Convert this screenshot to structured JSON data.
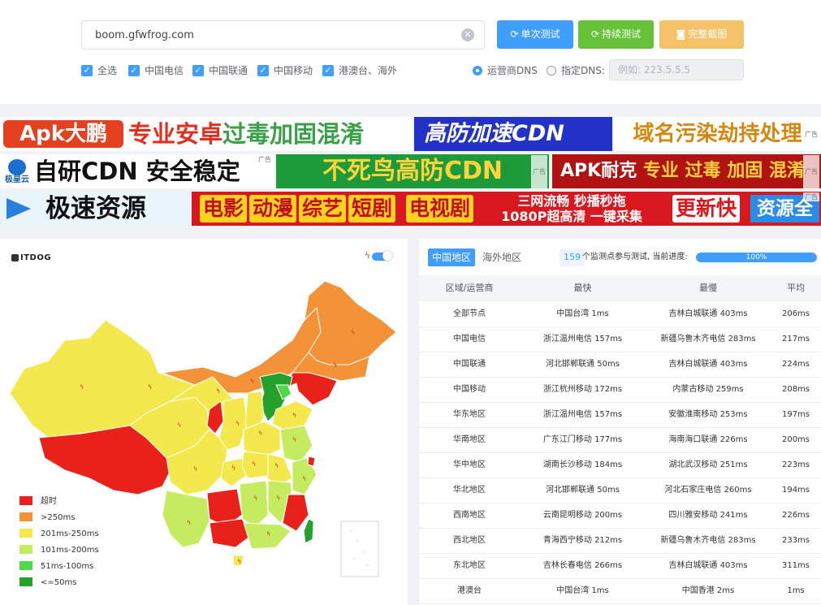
{
  "search": {
    "value": "boom.gfwfrog.com",
    "clear_icon": "circle-x-icon"
  },
  "actions": {
    "single_test": "单次测试",
    "continuous_test": "持续测试",
    "full_screenshot": "完整截图"
  },
  "filters": [
    {
      "label": "全选",
      "checked": true
    },
    {
      "label": "中国电信",
      "checked": true
    },
    {
      "label": "中国联通",
      "checked": true
    },
    {
      "label": "中国移动",
      "checked": true
    },
    {
      "label": "港澳台、海外",
      "checked": true
    }
  ],
  "dns": {
    "operator_dns": "运营商DNS",
    "custom_dns": "指定DNS:",
    "selected": "运营商DNS",
    "placeholder": "例如: 223.5.5.5"
  },
  "ads": {
    "ad1_badge": "Apk大鹏",
    "ad1_text": "专业安卓",
    "ad1_highlight": "过毒加固混淆",
    "ad2": "高防加速CDN",
    "ad3": "域名污染劫持处理",
    "ad4_logo": "极星云",
    "ad4": "自研CDN 安全稳定",
    "ad5": "不死鸟高防CDN",
    "ad6_a": "APK耐克",
    "ad6_b": "专业 过毒 加固 混淆",
    "ad7": "极速资源",
    "ad8_chips": [
      "电影",
      "动漫",
      "综艺",
      "短剧",
      "电视剧"
    ],
    "ad8_mid1": "三网流畅   秒播秒拖",
    "ad8_mid2": "1080P超高清   一键采集",
    "ad8_update": "更新快",
    "ad8_res": "资源全",
    "ad_tag": "广告"
  },
  "map": {
    "logo": "ITDOG",
    "legend": [
      {
        "label": "超时",
        "color": "#e8211b"
      },
      {
        "label": ">250ms",
        "color": "#f39237"
      },
      {
        "label": "201ms-250ms",
        "color": "#f3e84c"
      },
      {
        "label": "101ms-200ms",
        "color": "#c5ec61"
      },
      {
        "label": "51ms-100ms",
        "color": "#4fd84e"
      },
      {
        "label": "<=50ms",
        "color": "#23a12a"
      }
    ]
  },
  "results": {
    "tabs": [
      "中国地区",
      "海外地区"
    ],
    "active_tab": "中国地区",
    "node_count": "159",
    "progress_text": "个监测点参与测试, 当前进度:",
    "progress_percent": 100,
    "progress_label": "100%",
    "columns": [
      "区域/运营商",
      "最快",
      "最慢",
      "平均"
    ],
    "rows": [
      [
        "全部节点",
        "中国台湾 1ms",
        "吉林白城联通 403ms",
        "206ms"
      ],
      [
        "中国电信",
        "浙江温州电信 157ms",
        "新疆乌鲁木齐电信 283ms",
        "217ms"
      ],
      [
        "中国联通",
        "河北邯郸联通 50ms",
        "吉林白城联通 403ms",
        "224ms"
      ],
      [
        "中国移动",
        "浙江杭州移动 172ms",
        "内蒙古移动 259ms",
        "208ms"
      ],
      [
        "华东地区",
        "浙江温州电信 157ms",
        "安徽淮南移动 253ms",
        "197ms"
      ],
      [
        "华南地区",
        "广东江门移动 177ms",
        "海南海口联通 226ms",
        "200ms"
      ],
      [
        "华中地区",
        "湖南长沙移动 184ms",
        "湖北武汉移动 251ms",
        "223ms"
      ],
      [
        "华北地区",
        "河北邯郸联通 50ms",
        "河北石家庄电信 260ms",
        "194ms"
      ],
      [
        "西南地区",
        "云南昆明移动 200ms",
        "四川雅安移动 241ms",
        "226ms"
      ],
      [
        "西北地区",
        "青海西宁移动 212ms",
        "新疆乌鲁木齐电信 283ms",
        "233ms"
      ],
      [
        "东北地区",
        "吉林长春电信 266ms",
        "吉林白城联通 403ms",
        "311ms"
      ],
      [
        "港澳台",
        "中国台湾 1ms",
        "中国香港 2ms",
        "1ms"
      ]
    ]
  }
}
